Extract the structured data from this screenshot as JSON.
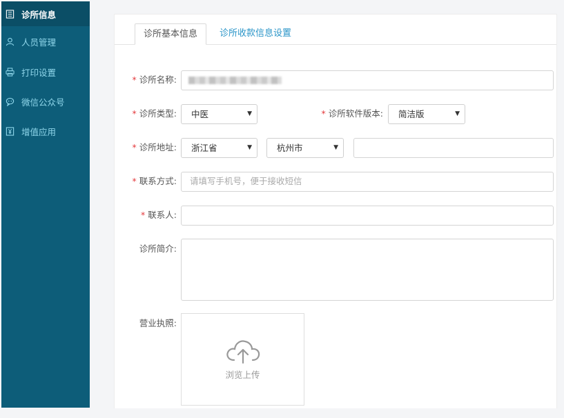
{
  "sidebar": {
    "items": [
      {
        "label": "诊所信息",
        "icon": "document-list-icon"
      },
      {
        "label": "人员管理",
        "icon": "user-icon"
      },
      {
        "label": "打印设置",
        "icon": "printer-icon"
      },
      {
        "label": "微信公众号",
        "icon": "chat-bubble-icon"
      },
      {
        "label": "增值应用",
        "icon": "yuan-icon"
      }
    ],
    "active_index": 0
  },
  "tabs": [
    {
      "label": "诊所基本信息",
      "active": true
    },
    {
      "label": "诊所收款信息设置",
      "active": false
    }
  ],
  "form": {
    "clinic_name": {
      "label": "诊所名称:",
      "required": true
    },
    "clinic_type": {
      "label": "诊所类型:",
      "required": true,
      "value": "中医"
    },
    "software_version": {
      "label": "诊所软件版本:",
      "required": true,
      "value": "简洁版"
    },
    "address": {
      "label": "诊所地址:",
      "required": true,
      "province": "浙江省",
      "city": "杭州市",
      "detail": ""
    },
    "contact_method": {
      "label": "联系方式:",
      "required": true,
      "placeholder": "请填写手机号，便于接收短信"
    },
    "contact_person": {
      "label": "联系人:",
      "required": true,
      "value": ""
    },
    "intro": {
      "label": "诊所简介:",
      "required": false,
      "value": ""
    },
    "license": {
      "label": "营业执照:",
      "required": false,
      "upload_text": "浏览上传"
    }
  },
  "colors": {
    "sidebar_bg": "#0d5d79",
    "sidebar_active_bg": "#0b4e66",
    "sidebar_text": "#8fd6ea",
    "tab_link": "#2a95c8",
    "required_star": "#e4393c"
  }
}
